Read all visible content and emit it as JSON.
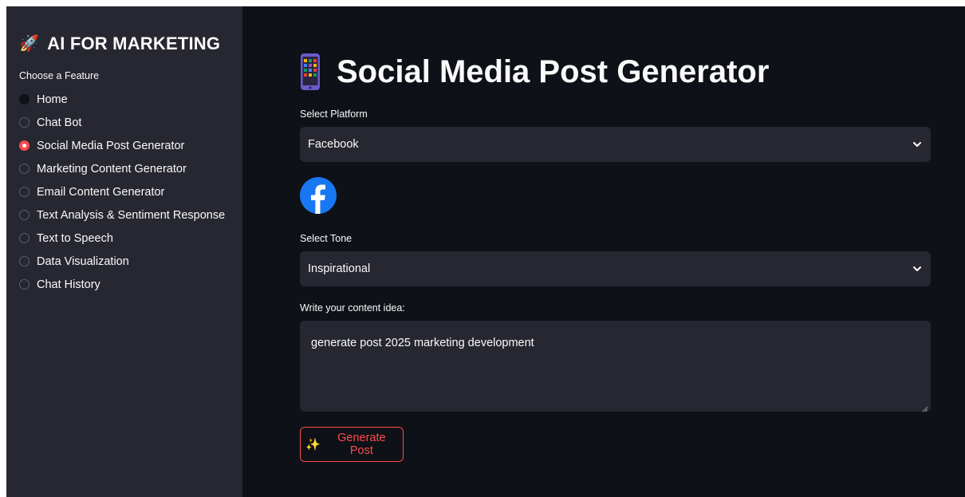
{
  "sidebar": {
    "title": "AI FOR MARKETING",
    "title_icon": "rocket-icon",
    "choose_label": "Choose a Feature",
    "items": [
      {
        "label": "Home",
        "selected": false
      },
      {
        "label": "Chat Bot",
        "selected": false
      },
      {
        "label": "Social Media Post Generator",
        "selected": true
      },
      {
        "label": "Marketing Content Generator",
        "selected": false
      },
      {
        "label": "Email Content Generator",
        "selected": false
      },
      {
        "label": "Text Analysis & Sentiment Response",
        "selected": false
      },
      {
        "label": "Text to Speech",
        "selected": false
      },
      {
        "label": "Data Visualization",
        "selected": false
      },
      {
        "label": "Chat History",
        "selected": false
      }
    ]
  },
  "main": {
    "title": "Social Media Post Generator",
    "title_icon": "mobile-phone-icon",
    "platform": {
      "label": "Select Platform",
      "value": "Facebook",
      "logo_icon": "facebook-icon"
    },
    "tone": {
      "label": "Select Tone",
      "value": "Inspirational"
    },
    "content": {
      "label": "Write your content idea:",
      "value": "generate post 2025 marketing development"
    },
    "generate_button": {
      "label": "Generate Post",
      "icon": "sparkles-icon"
    }
  },
  "colors": {
    "sidebar_bg": "#262730",
    "main_bg": "#0e1117",
    "input_bg": "#262730",
    "accent": "#ff4b4b",
    "facebook_blue": "#1877f2"
  }
}
